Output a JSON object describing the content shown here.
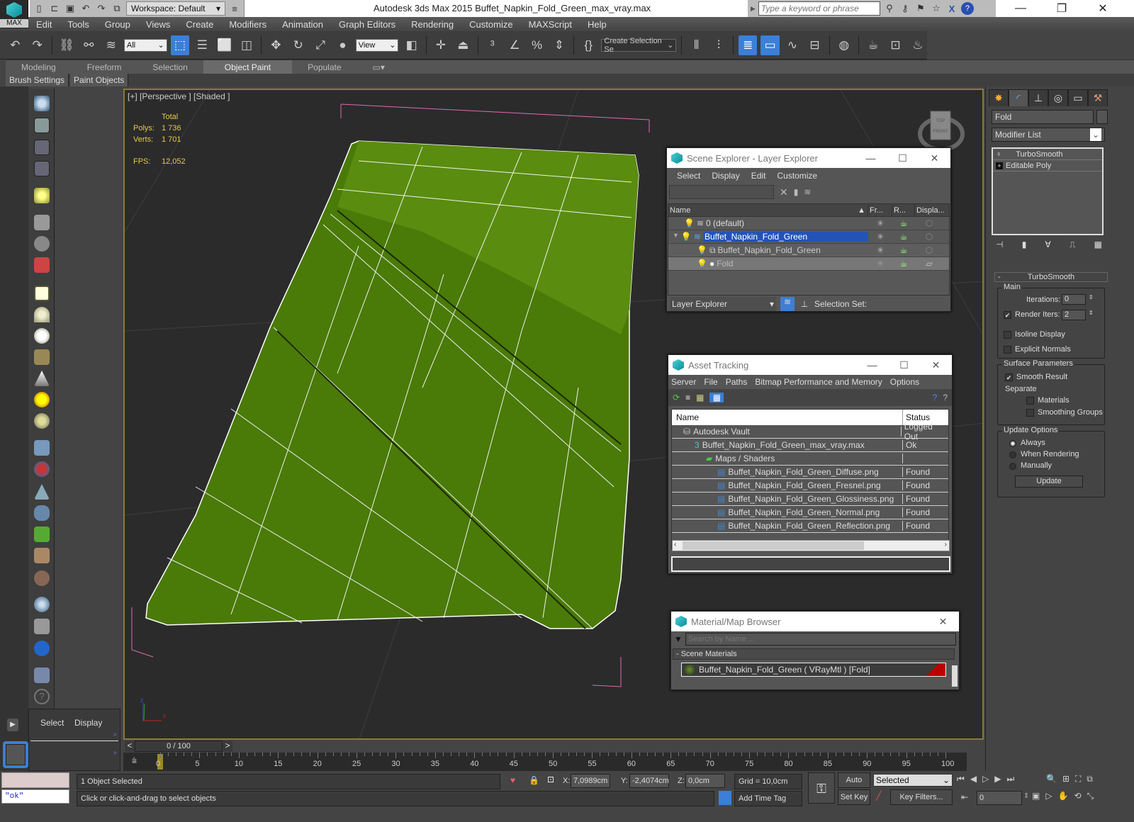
{
  "app": {
    "logo_label": "MAX",
    "title": "Autodesk 3ds Max  2015     Buffet_Napkin_Fold_Green_max_vray.max",
    "workspace": "Workspace: Default",
    "search_placeholder": "Type a keyword or phrase"
  },
  "menubar": [
    "Edit",
    "Tools",
    "Group",
    "Views",
    "Create",
    "Modifiers",
    "Animation",
    "Graph Editors",
    "Rendering",
    "Customize",
    "MAXScript",
    "Help"
  ],
  "toolbar": {
    "selection_filter": "All",
    "ref_coord": "View",
    "selection_set": "Create Selection Se"
  },
  "ribbon": {
    "tabs": [
      "Modeling",
      "Freeform",
      "Selection",
      "Object Paint",
      "Populate"
    ],
    "active_tab": "Object Paint",
    "subtabs": [
      "Brush Settings",
      "Paint Objects"
    ]
  },
  "viewport": {
    "label": "[+] [Perspective ] [Shaded ]",
    "stats_header": "Total",
    "polys_label": "Polys:",
    "polys": "1 736",
    "verts_label": "Verts:",
    "verts": "1 701",
    "fps_label": "FPS:",
    "fps": "12,052",
    "viewcube_top": "TOP",
    "viewcube_front": "FRONT",
    "axis_x": "x",
    "axis_z": "z"
  },
  "scene_explorer": {
    "title": "Scene Explorer - Layer Explorer",
    "menu": [
      "Select",
      "Display",
      "Edit",
      "Customize"
    ],
    "columns": [
      "Name",
      "Fr...",
      "R...",
      "Displa..."
    ],
    "rows": [
      {
        "name": "0 (default)",
        "level": 0,
        "type": "layer"
      },
      {
        "name": "Buffet_Napkin_Fold_Green",
        "level": 0,
        "type": "layer",
        "selected": true,
        "expanded": true
      },
      {
        "name": "Buffet_Napkin_Fold_Green",
        "level": 1,
        "type": "group"
      },
      {
        "name": "Fold",
        "level": 1,
        "type": "object",
        "dim": true
      }
    ],
    "footer_dropdown": "Layer Explorer",
    "selection_set_label": "Selection Set:"
  },
  "asset_tracking": {
    "title": "Asset Tracking",
    "menu": [
      "Server",
      "File",
      "Paths",
      "Bitmap Performance and Memory",
      "Options"
    ],
    "columns": [
      "Name",
      "Status"
    ],
    "rows": [
      {
        "name": "Autodesk Vault",
        "status": "Logged Out",
        "indent": 1,
        "icon": "vault"
      },
      {
        "name": "Buffet_Napkin_Fold_Green_max_vray.max",
        "status": "Ok",
        "indent": 2,
        "icon": "max"
      },
      {
        "name": "Maps / Shaders",
        "status": "",
        "indent": 3,
        "icon": "maps"
      },
      {
        "name": "Buffet_Napkin_Fold_Green_Diffuse.png",
        "status": "Found",
        "indent": 4,
        "icon": "image"
      },
      {
        "name": "Buffet_Napkin_Fold_Green_Fresnel.png",
        "status": "Found",
        "indent": 4,
        "icon": "image"
      },
      {
        "name": "Buffet_Napkin_Fold_Green_Glossiness.png",
        "status": "Found",
        "indent": 4,
        "icon": "image"
      },
      {
        "name": "Buffet_Napkin_Fold_Green_Normal.png",
        "status": "Found",
        "indent": 4,
        "icon": "image"
      },
      {
        "name": "Buffet_Napkin_Fold_Green_Reflection.png",
        "status": "Found",
        "indent": 4,
        "icon": "image"
      }
    ]
  },
  "material_browser": {
    "title": "Material/Map Browser",
    "search_placeholder": "Search by Name ...",
    "section": "- Scene Materials",
    "material": "Buffet_Napkin_Fold_Green  ( VRayMtl ) [Fold]"
  },
  "command_panel": {
    "object_name": "Fold",
    "modifier_list": "Modifier List",
    "stack": [
      "TurboSmooth",
      "Editable Poly"
    ],
    "rollout_title": "TurboSmooth",
    "main_group": "Main",
    "iterations_label": "Iterations:",
    "iterations": "0",
    "render_iters_label": "Render Iters:",
    "render_iters": "2",
    "render_iters_checked": true,
    "isoline_label": "Isoline Display",
    "isoline_checked": false,
    "explicit_normals_label": "Explicit Normals",
    "explicit_normals_checked": false,
    "surface_group": "Surface Parameters",
    "smooth_result_label": "Smooth Result",
    "smooth_result_checked": true,
    "separate_label": "Separate",
    "materials_label": "Materials",
    "smoothing_groups_label": "Smoothing Groups",
    "update_group": "Update Options",
    "update_options": [
      "Always",
      "When Rendering",
      "Manually"
    ],
    "update_selected": "Always",
    "update_button": "Update"
  },
  "bottom": {
    "select_label": "Select",
    "display_label": "Display",
    "time_slider": "0 / 100",
    "ticks": [
      "0",
      "5",
      "10",
      "15",
      "20",
      "25",
      "30",
      "35",
      "40",
      "45",
      "50",
      "55",
      "60",
      "65",
      "70",
      "75",
      "80",
      "85",
      "90",
      "95",
      "100"
    ],
    "maxscript_result": "\"ok\"",
    "status_selected": "1 Object Selected",
    "prompt": "Click or click-and-drag to select objects",
    "x_label": "X:",
    "x": "7,0989cm",
    "y_label": "Y:",
    "y": "-2,4074cm",
    "z_label": "Z:",
    "z": "0,0cm",
    "grid": "Grid = 10,0cm",
    "add_time_tag": "Add Time Tag",
    "auto_key": "Auto Key",
    "set_key": "Set Key",
    "key_mode": "Selected",
    "key_filters": "Key Filters...",
    "frame": "0"
  }
}
